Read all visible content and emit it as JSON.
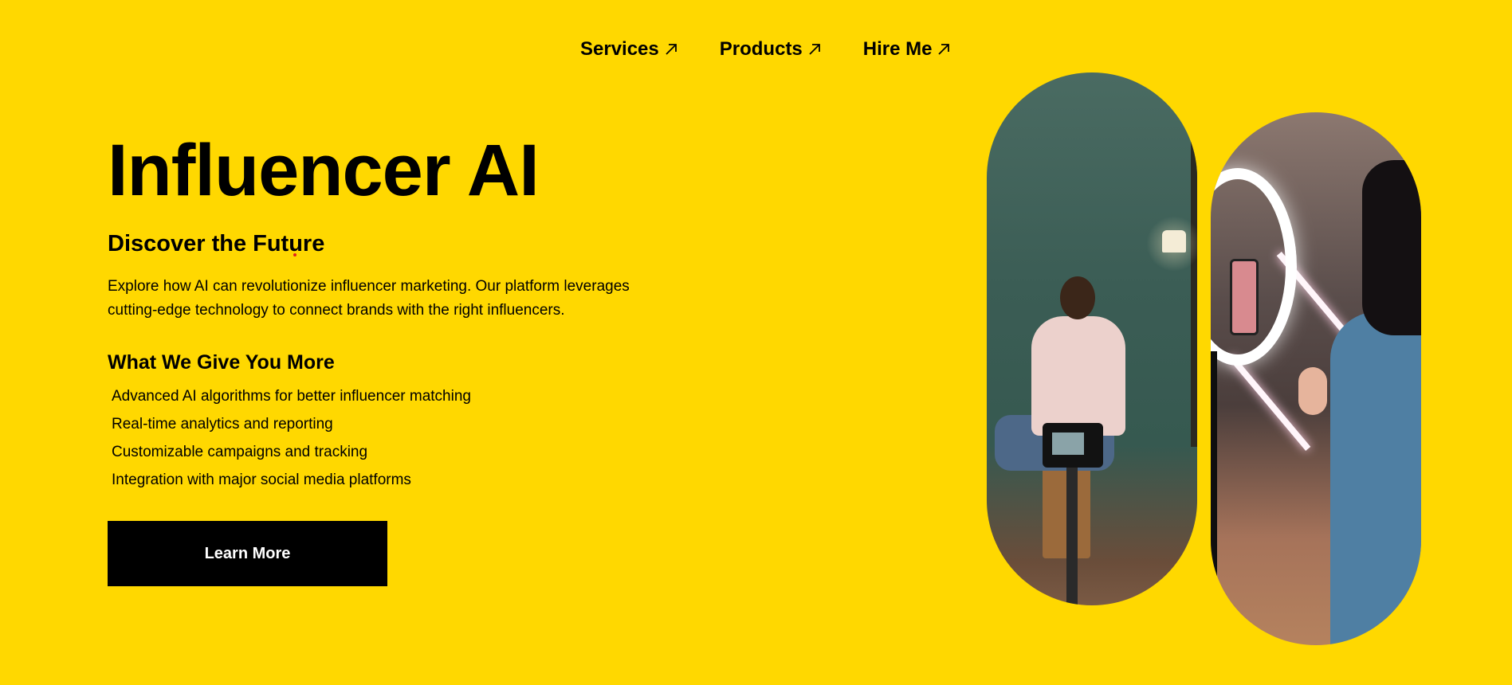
{
  "nav": {
    "items": [
      {
        "label": "Services"
      },
      {
        "label": "Products"
      },
      {
        "label": "Hire Me"
      }
    ]
  },
  "hero": {
    "title": "Influencer AI",
    "subtitle": "Discover the Future",
    "description": "Explore how AI can revolutionize influencer marketing. Our platform leverages cutting-edge technology to connect brands with the right influencers.",
    "section_heading": "What We Give You More",
    "features": [
      "Advanced AI algorithms for better influencer matching",
      "Real-time analytics and reporting",
      "Customizable campaigns and tracking",
      "Integration with major social media platforms"
    ],
    "cta_label": "Learn More"
  },
  "colors": {
    "background": "#FFD800",
    "button": "#000000",
    "button_text": "#FFFFFF"
  },
  "icons": {
    "nav_arrow": "arrow-up-right-icon"
  }
}
